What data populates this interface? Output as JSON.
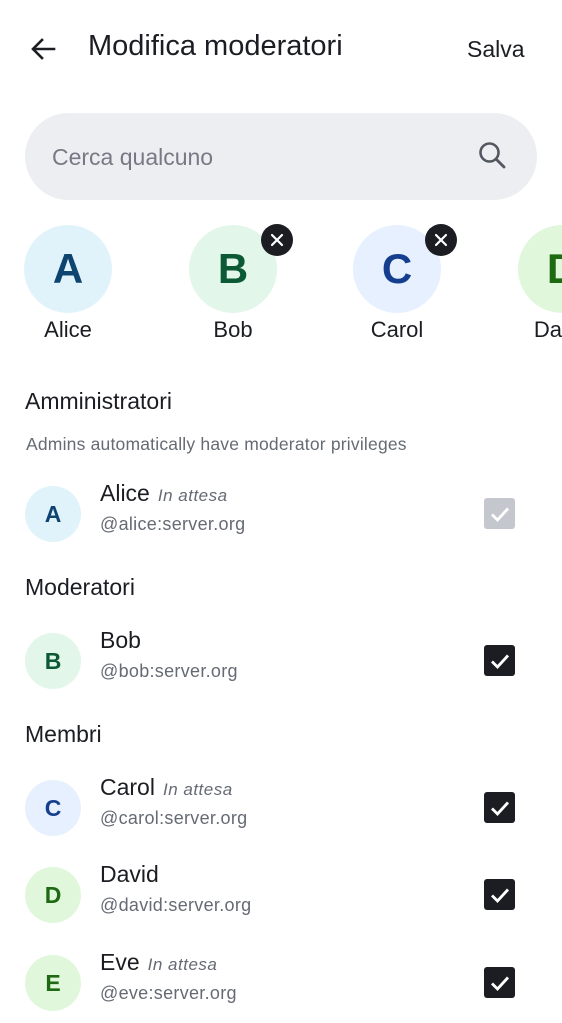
{
  "header": {
    "title": "Modifica moderatori",
    "save_label": "Salva",
    "back_icon": "arrow-left-icon"
  },
  "search": {
    "placeholder": "Cerca qualcuno",
    "value": "",
    "icon": "search-icon"
  },
  "selected": [
    {
      "initial": "A",
      "name": "Alice",
      "bg": "#e0f3fa",
      "fg": "#0e4470",
      "removable": false
    },
    {
      "initial": "B",
      "name": "Bob",
      "bg": "#e2f6ea",
      "fg": "#0b5a35",
      "removable": true
    },
    {
      "initial": "C",
      "name": "Carol",
      "bg": "#e6f0ff",
      "fg": "#163e8f",
      "removable": true
    },
    {
      "initial": "D",
      "name": "David",
      "bg": "#e1f7dc",
      "fg": "#1e6a12",
      "removable": false
    }
  ],
  "sections": {
    "admins": {
      "title": "Amministratori",
      "subtitle": "Admins automatically have moderator privileges"
    },
    "moderators": {
      "title": "Moderatori"
    },
    "members": {
      "title": "Membri"
    }
  },
  "members": [
    {
      "initial": "A",
      "name": "Alice",
      "status": "In attesa",
      "handle": "@alice:server.org",
      "bg": "#e0f3fa",
      "fg": "#0e4470",
      "checked": true,
      "disabled": true
    },
    {
      "initial": "B",
      "name": "Bob",
      "status": "",
      "handle": "@bob:server.org",
      "bg": "#e2f6ea",
      "fg": "#0b5a35",
      "checked": true,
      "disabled": false
    },
    {
      "initial": "C",
      "name": "Carol",
      "status": "In attesa",
      "handle": "@carol:server.org",
      "bg": "#e6f0ff",
      "fg": "#163e8f",
      "checked": true,
      "disabled": false
    },
    {
      "initial": "D",
      "name": "David",
      "status": "",
      "handle": "@david:server.org",
      "bg": "#e1f7dc",
      "fg": "#1e6a12",
      "checked": true,
      "disabled": false
    },
    {
      "initial": "E",
      "name": "Eve",
      "status": "In attesa",
      "handle": "@eve:server.org",
      "bg": "#e1f7dc",
      "fg": "#1e6a12",
      "checked": true,
      "disabled": false
    }
  ]
}
